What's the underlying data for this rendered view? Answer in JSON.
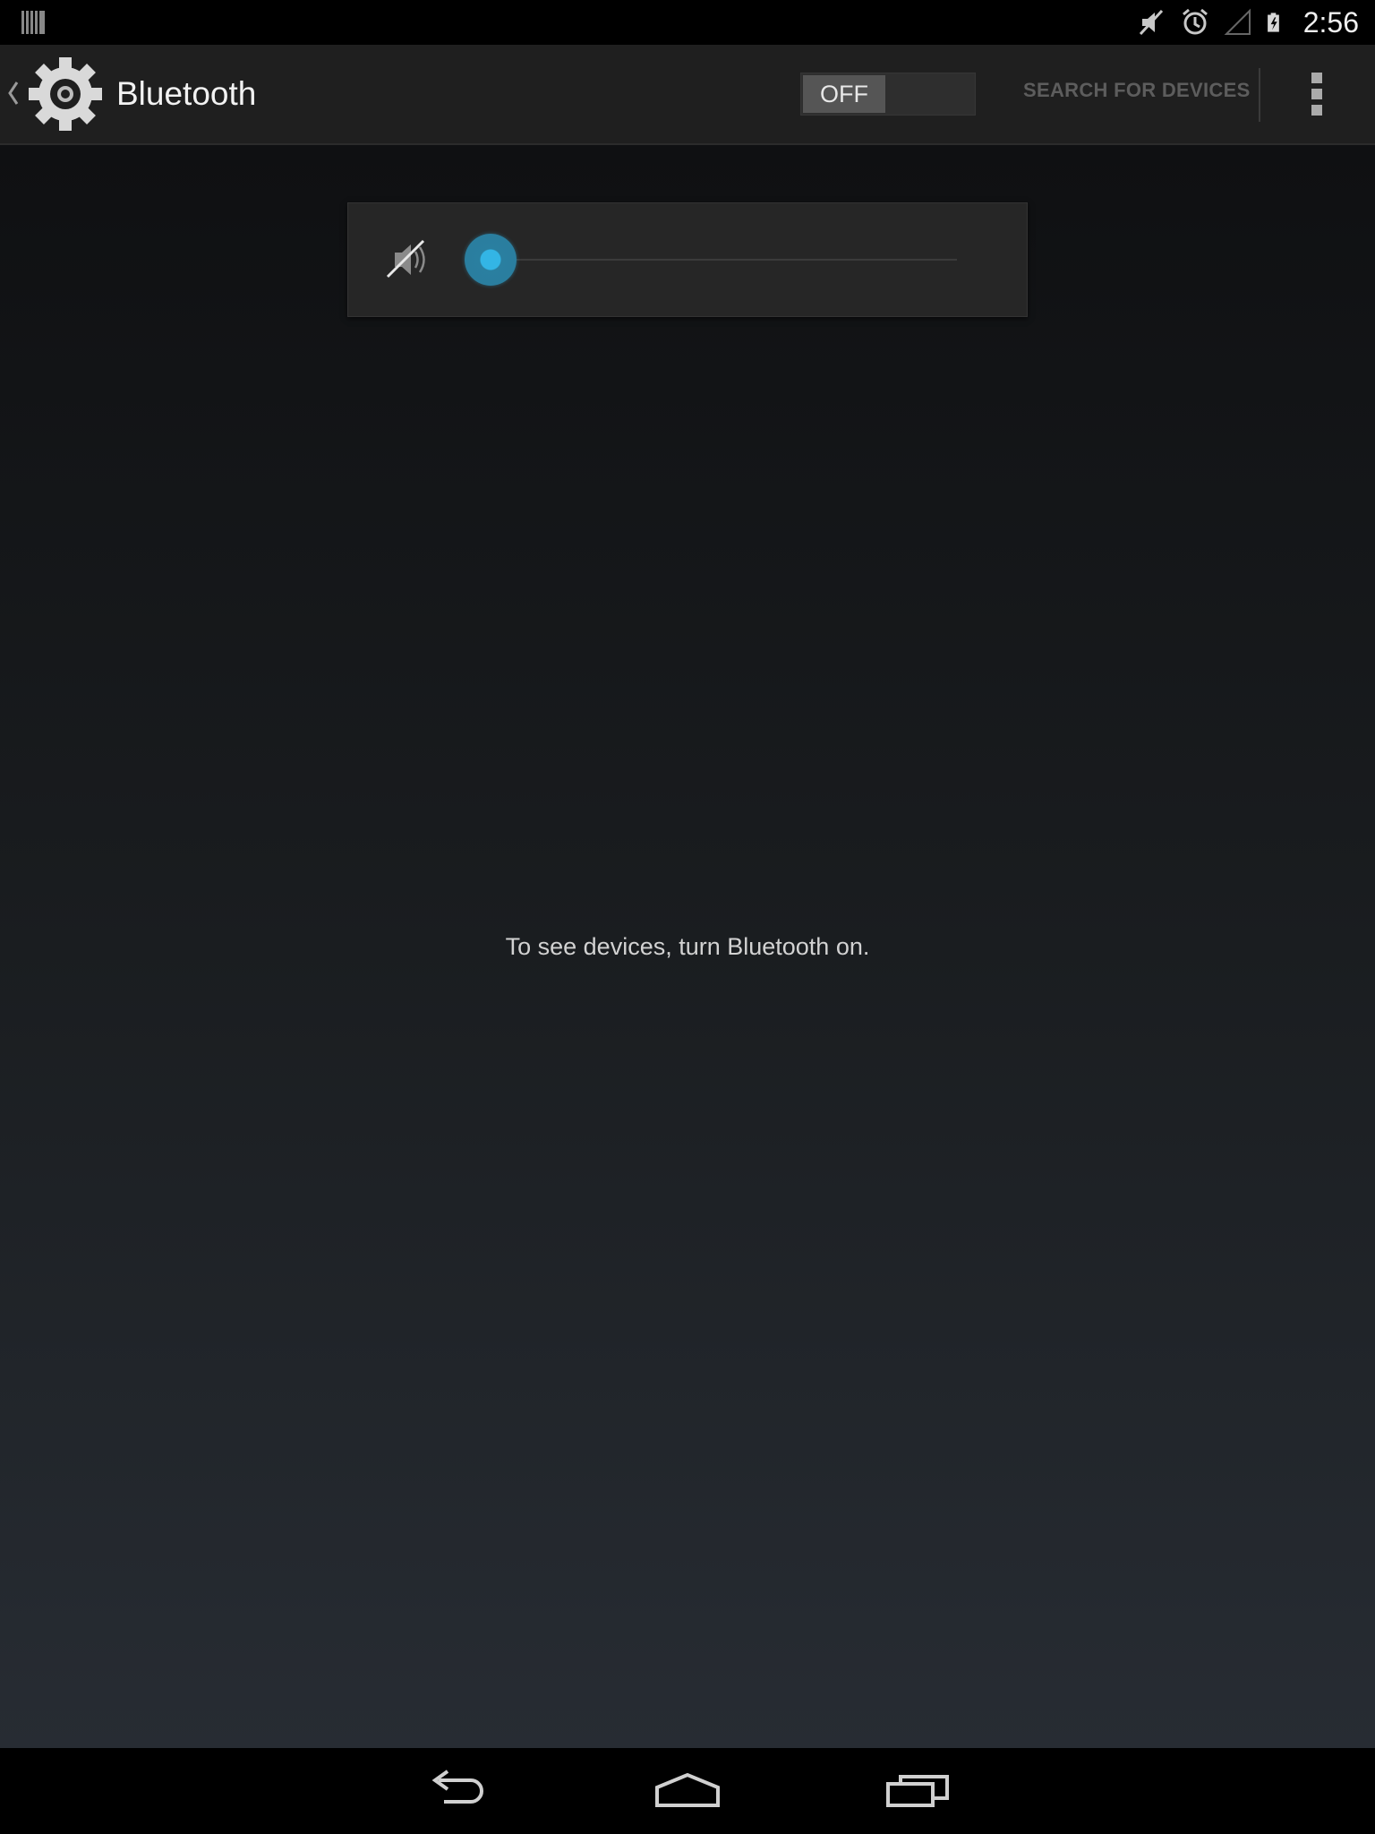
{
  "status_bar": {
    "time": "2:56",
    "icons": [
      "barcode-icon",
      "mute-icon",
      "alarm-icon",
      "no-signal-icon",
      "battery-charging-icon"
    ]
  },
  "action_bar": {
    "title": "Bluetooth",
    "toggle_label": "OFF",
    "search_label": "SEARCH FOR DEVICES",
    "icons": [
      "up-caret-icon",
      "settings-gear-icon",
      "overflow-menu-icon"
    ]
  },
  "volume_panel": {
    "level": 0,
    "muted": true,
    "accent": "#33b5e5"
  },
  "content": {
    "message": "To see devices, turn Bluetooth on."
  },
  "nav_bar": {
    "buttons": [
      "back-icon",
      "home-icon",
      "recents-icon"
    ]
  }
}
